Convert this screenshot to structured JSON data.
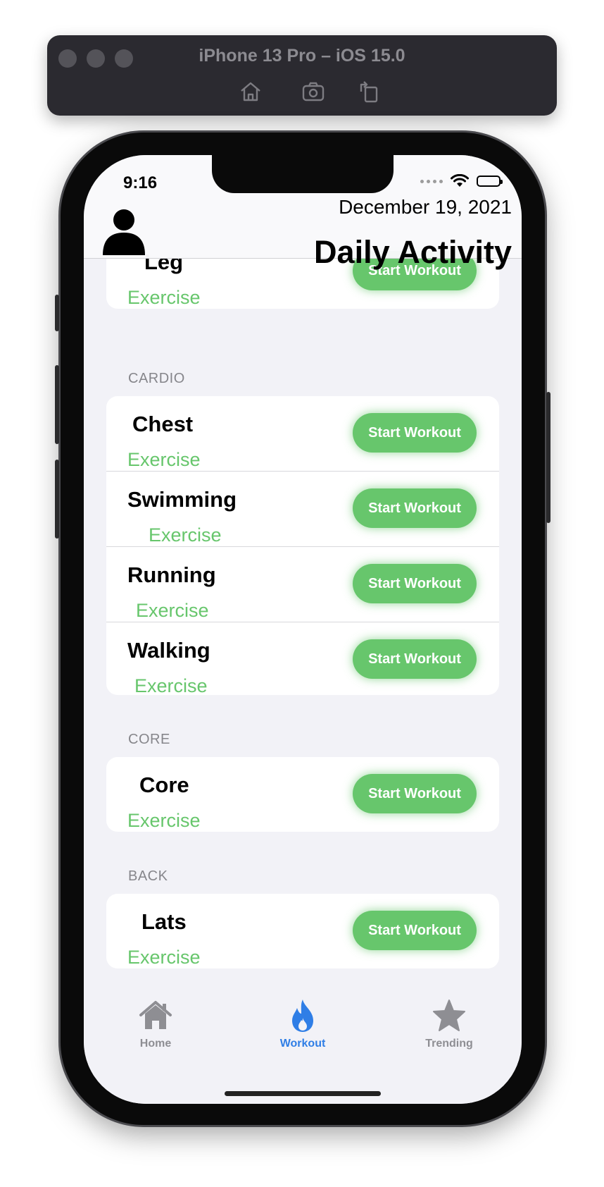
{
  "simulator": {
    "title": "iPhone 13 Pro – iOS 15.0",
    "icons": [
      "home-icon",
      "screenshot-icon",
      "rotate-icon"
    ]
  },
  "status_bar": {
    "time": "9:16",
    "icons": [
      "cellular-dots-icon",
      "wifi-icon",
      "battery-icon"
    ]
  },
  "header": {
    "date": "December 19, 2021",
    "title": "Daily Activity",
    "avatar_icon": "person-icon"
  },
  "sections": {
    "top": {
      "items": [
        {
          "title": "Leg",
          "subtitle": "Exercise",
          "button": "Start Workout"
        }
      ]
    },
    "cardio": {
      "label": "CARDIO",
      "items": [
        {
          "title": "Chest",
          "subtitle": "Exercise",
          "button": "Start Workout"
        },
        {
          "title": "Swimming",
          "subtitle": "Exercise",
          "button": "Start Workout"
        },
        {
          "title": "Running",
          "subtitle": "Exercise",
          "button": "Start Workout"
        },
        {
          "title": "Walking",
          "subtitle": "Exercise",
          "button": "Start Workout"
        }
      ]
    },
    "core": {
      "label": "CORE",
      "items": [
        {
          "title": "Core",
          "subtitle": "Exercise",
          "button": "Start Workout"
        }
      ]
    },
    "back": {
      "label": "BACK",
      "items": [
        {
          "title": "Lats",
          "subtitle": "Exercise",
          "button": "Start Workout"
        }
      ]
    }
  },
  "tabs": [
    {
      "label": "Home",
      "icon": "house-icon",
      "active": false
    },
    {
      "label": "Workout",
      "icon": "flame-icon",
      "active": true
    },
    {
      "label": "Trending",
      "icon": "star-icon",
      "active": false
    }
  ],
  "colors": {
    "accent_green": "#67c66c",
    "tab_active": "#2f7ee6",
    "tab_inactive": "#8e8e93",
    "background": "#f2f2f7"
  }
}
